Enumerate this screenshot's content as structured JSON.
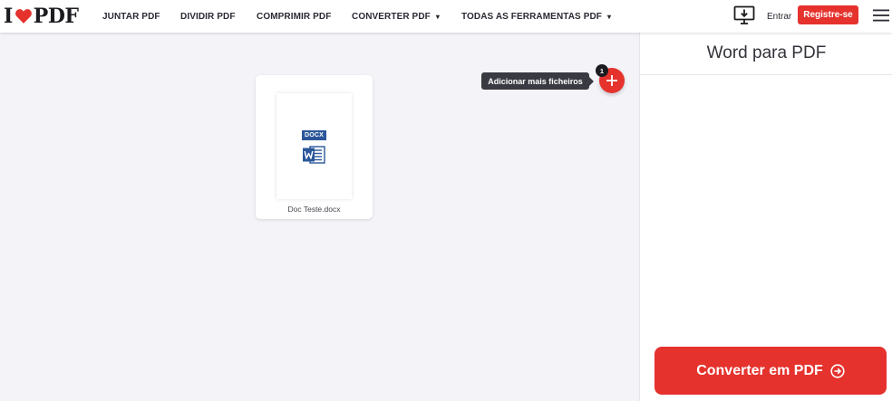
{
  "header": {
    "logo": {
      "left": "I",
      "right": "PDF"
    },
    "nav": [
      {
        "label": "JUNTAR PDF"
      },
      {
        "label": "DIVIDIR PDF"
      },
      {
        "label": "COMPRIMIR PDF"
      },
      {
        "label": "CONVERTER PDF",
        "caret": "▾"
      },
      {
        "label": "TODAS AS FERRAMENTAS PDF",
        "caret": "▾"
      }
    ],
    "desktop_icon": "desktop-download-icon",
    "login_label": "Entrar",
    "register_label": "Registre-se",
    "menu_icon": "hamburger-icon"
  },
  "workspace": {
    "file": {
      "type_label": "DOCX",
      "icon": "word-file-icon",
      "name": "Doc Teste.docx"
    },
    "add_tooltip": "Adicionar mais ficheiros",
    "file_count": "1",
    "add_icon": "plus-icon"
  },
  "sidebar": {
    "title": "Word para PDF",
    "convert_label": "Converter em PDF",
    "convert_icon": "arrow-right-circle-icon"
  },
  "colors": {
    "brand_red": "#e5322d",
    "word_blue": "#2b579a",
    "workspace_bg": "#f4f4f8",
    "tooltip_bg": "#3a3a42"
  }
}
